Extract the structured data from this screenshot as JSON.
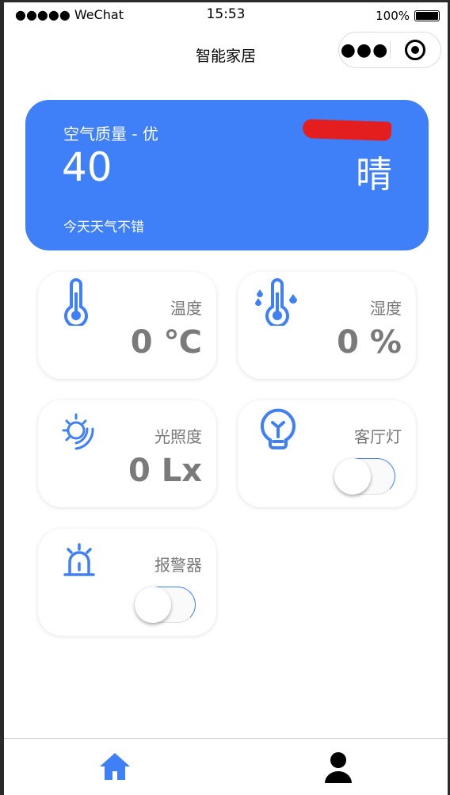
{
  "status_bar": {
    "carrier": "●●●●● WeChat",
    "time": "15:53",
    "battery": "100%",
    "battery_level": 1.0
  },
  "nav": {
    "title": "智能家居",
    "more_icon": "more-dots-icon",
    "close_icon": "target-icon"
  },
  "banner": {
    "air_quality_label": "空气质量 - 优",
    "aqi": "40",
    "message": "今天天气不错",
    "weather": "晴",
    "bg_color": "#3f80f9"
  },
  "cards": [
    {
      "icon": "thermometer-icon",
      "label": "温度",
      "value": "0 ℃"
    },
    {
      "icon": "humidity-icon",
      "label": "湿度",
      "value": "0 %"
    },
    {
      "icon": "sun-icon",
      "label": "光照度",
      "value": "0 Lx"
    },
    {
      "icon": "bulb-icon",
      "label": "客厅灯",
      "toggle_on": false
    },
    {
      "icon": "alarm-icon",
      "label": "报警器",
      "toggle_on": false
    }
  ],
  "tabbar": {
    "items": [
      {
        "icon": "home-icon",
        "active": true,
        "color": "#3f80f9"
      },
      {
        "icon": "user-icon",
        "active": false,
        "color": "#000000"
      }
    ]
  }
}
